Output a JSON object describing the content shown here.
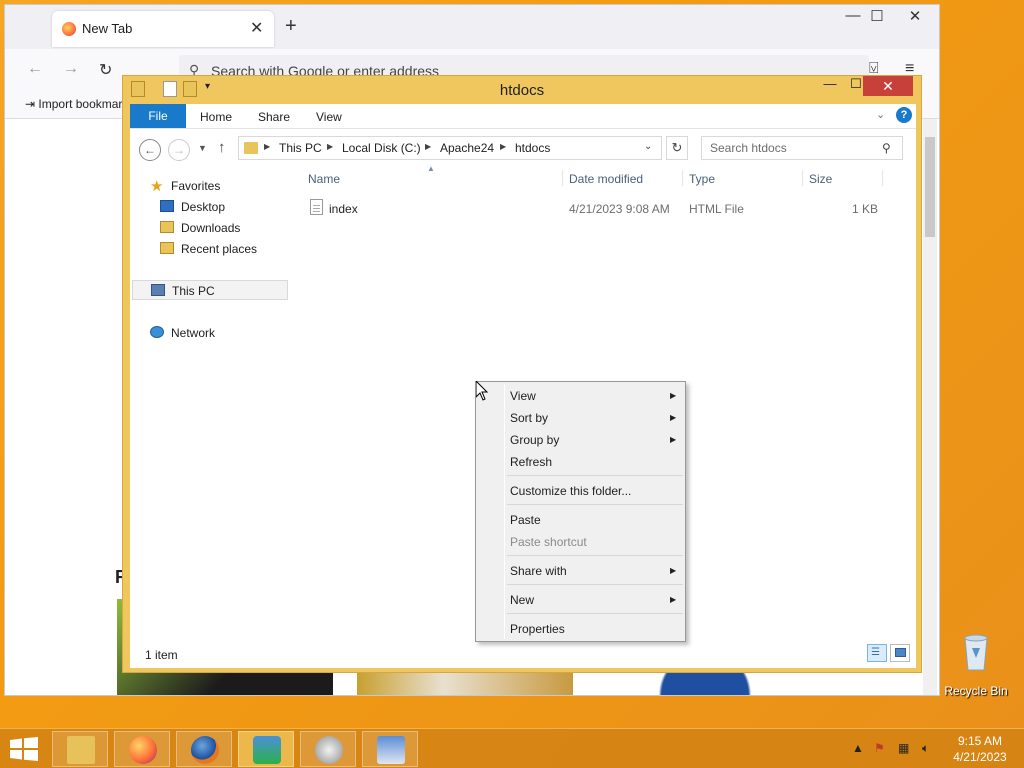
{
  "browser": {
    "tab_title": "New Tab",
    "url_placeholder": "Search with Google or enter address",
    "bookmark_import": "Import bookmarks...",
    "content_heading": "R"
  },
  "explorer": {
    "title": "htdocs",
    "ribbon_tabs": [
      "File",
      "Home",
      "Share",
      "View"
    ],
    "breadcrumb": [
      "This PC",
      "Local Disk (C:)",
      "Apache24",
      "htdocs"
    ],
    "search_placeholder": "Search htdocs",
    "nav": {
      "favorites": "Favorites",
      "desktop": "Desktop",
      "downloads": "Downloads",
      "recent": "Recent places",
      "thispc": "This PC",
      "network": "Network"
    },
    "columns": [
      "Name",
      "Date modified",
      "Type",
      "Size"
    ],
    "files": [
      {
        "name": "index",
        "date": "4/21/2023 9:08 AM",
        "type": "HTML File",
        "size": "1 KB"
      }
    ],
    "status": "1 item"
  },
  "context_menu": {
    "items": [
      {
        "label": "View",
        "submenu": true
      },
      {
        "label": "Sort by",
        "submenu": true
      },
      {
        "label": "Group by",
        "submenu": true
      },
      {
        "label": "Refresh",
        "submenu": false
      },
      {
        "label": "Customize this folder...",
        "submenu": false
      },
      {
        "label": "Paste",
        "submenu": false
      },
      {
        "label": "Paste shortcut",
        "submenu": false,
        "disabled": true
      },
      {
        "label": "Share with",
        "submenu": true
      },
      {
        "label": "New",
        "submenu": true
      },
      {
        "label": "Properties",
        "submenu": false
      }
    ]
  },
  "desktop": {
    "recycle_bin": "Recycle Bin"
  },
  "taskbar": {
    "clock_time": "9:15 AM",
    "clock_date": "4/21/2023"
  }
}
